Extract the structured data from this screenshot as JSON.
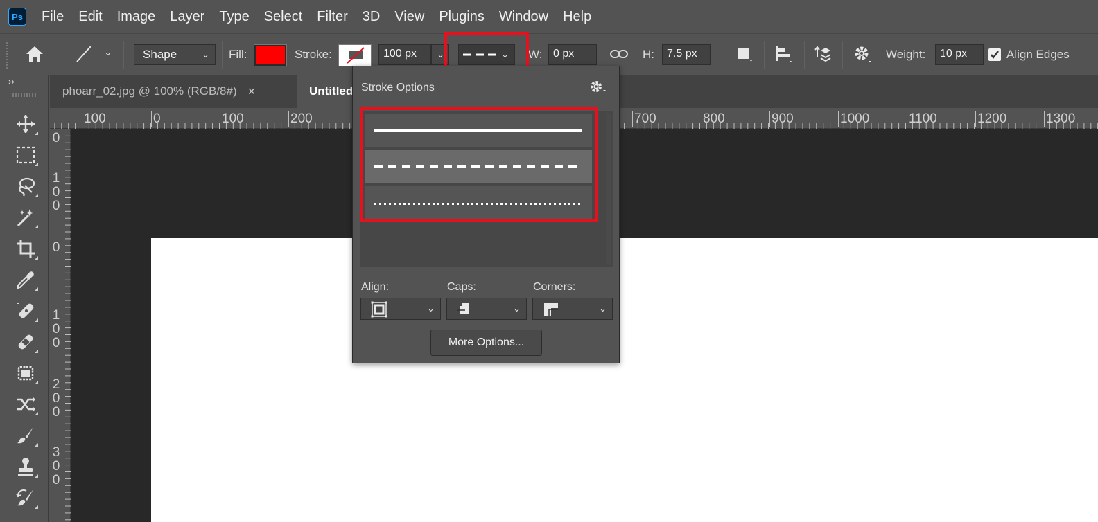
{
  "app": {
    "logo": "Ps"
  },
  "menu": [
    "File",
    "Edit",
    "Image",
    "Layer",
    "Type",
    "Select",
    "Filter",
    "3D",
    "View",
    "Plugins",
    "Window",
    "Help"
  ],
  "options_bar": {
    "home_icon": "home-icon",
    "tool_icon": "line-tool-icon",
    "mode": "Shape",
    "fill_label": "Fill:",
    "fill_color": "#ff0000",
    "stroke_label": "Stroke:",
    "stroke_width": "100 px",
    "w_label": "W:",
    "w_value": "0 px",
    "h_label": "H:",
    "h_value": "7.5 px",
    "weight_label": "Weight:",
    "weight_value": "10 px",
    "align_edges_label": "Align Edges",
    "align_edges_checked": true
  },
  "tabs": [
    {
      "label": "phoarr_02.jpg @ 100% (RGB/8#)",
      "close": "×",
      "active": false
    },
    {
      "label": "Untitled",
      "active": true
    }
  ],
  "toolbar": {
    "collapse": "››",
    "tools": [
      "move-tool-icon",
      "marquee-tool-icon",
      "lasso-tool-icon",
      "magic-wand-icon",
      "crop-tool-icon",
      "eyedropper-icon",
      "spot-healing-icon",
      "healing-brush-icon",
      "patch-tool-icon",
      "content-aware-move-icon",
      "brush-tool-icon",
      "clone-stamp-icon",
      "history-brush-icon"
    ]
  },
  "rulers": {
    "top": [
      "100",
      "0",
      "100",
      "200",
      "700",
      "800",
      "900",
      "1000",
      "1100",
      "1200",
      "1300"
    ],
    "left": [
      [
        "0"
      ],
      [
        "1",
        "0",
        "0"
      ],
      [
        "0"
      ],
      [
        "1",
        "0",
        "0"
      ],
      [
        "2",
        "0",
        "0"
      ],
      [
        "3",
        "0",
        "0"
      ]
    ]
  },
  "stroke_popup": {
    "title": "Stroke Options",
    "presets": [
      "solid",
      "dashed",
      "dotted"
    ],
    "selected_preset": "dashed",
    "align_label": "Align:",
    "caps_label": "Caps:",
    "corners_label": "Corners:",
    "more_options": "More Options..."
  },
  "colors": {
    "highlight": "#e8101c",
    "panel": "#535353",
    "canvas": "#282828"
  }
}
